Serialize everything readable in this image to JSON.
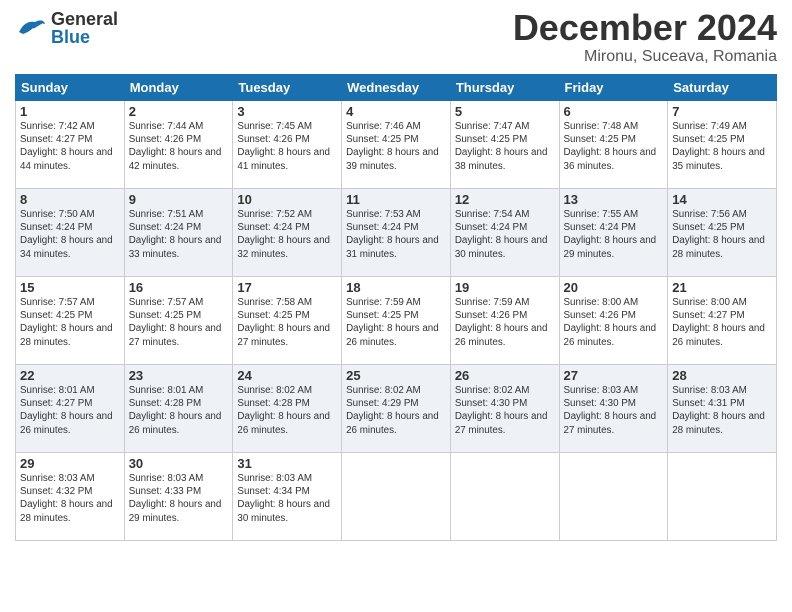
{
  "header": {
    "logo_general": "General",
    "logo_blue": "Blue",
    "month_title": "December 2024",
    "location": "Mironu, Suceava, Romania"
  },
  "days_of_week": [
    "Sunday",
    "Monday",
    "Tuesday",
    "Wednesday",
    "Thursday",
    "Friday",
    "Saturday"
  ],
  "weeks": [
    [
      {
        "day": "1",
        "sunrise": "Sunrise: 7:42 AM",
        "sunset": "Sunset: 4:27 PM",
        "daylight": "Daylight: 8 hours and 44 minutes."
      },
      {
        "day": "2",
        "sunrise": "Sunrise: 7:44 AM",
        "sunset": "Sunset: 4:26 PM",
        "daylight": "Daylight: 8 hours and 42 minutes."
      },
      {
        "day": "3",
        "sunrise": "Sunrise: 7:45 AM",
        "sunset": "Sunset: 4:26 PM",
        "daylight": "Daylight: 8 hours and 41 minutes."
      },
      {
        "day": "4",
        "sunrise": "Sunrise: 7:46 AM",
        "sunset": "Sunset: 4:25 PM",
        "daylight": "Daylight: 8 hours and 39 minutes."
      },
      {
        "day": "5",
        "sunrise": "Sunrise: 7:47 AM",
        "sunset": "Sunset: 4:25 PM",
        "daylight": "Daylight: 8 hours and 38 minutes."
      },
      {
        "day": "6",
        "sunrise": "Sunrise: 7:48 AM",
        "sunset": "Sunset: 4:25 PM",
        "daylight": "Daylight: 8 hours and 36 minutes."
      },
      {
        "day": "7",
        "sunrise": "Sunrise: 7:49 AM",
        "sunset": "Sunset: 4:25 PM",
        "daylight": "Daylight: 8 hours and 35 minutes."
      }
    ],
    [
      {
        "day": "8",
        "sunrise": "Sunrise: 7:50 AM",
        "sunset": "Sunset: 4:24 PM",
        "daylight": "Daylight: 8 hours and 34 minutes."
      },
      {
        "day": "9",
        "sunrise": "Sunrise: 7:51 AM",
        "sunset": "Sunset: 4:24 PM",
        "daylight": "Daylight: 8 hours and 33 minutes."
      },
      {
        "day": "10",
        "sunrise": "Sunrise: 7:52 AM",
        "sunset": "Sunset: 4:24 PM",
        "daylight": "Daylight: 8 hours and 32 minutes."
      },
      {
        "day": "11",
        "sunrise": "Sunrise: 7:53 AM",
        "sunset": "Sunset: 4:24 PM",
        "daylight": "Daylight: 8 hours and 31 minutes."
      },
      {
        "day": "12",
        "sunrise": "Sunrise: 7:54 AM",
        "sunset": "Sunset: 4:24 PM",
        "daylight": "Daylight: 8 hours and 30 minutes."
      },
      {
        "day": "13",
        "sunrise": "Sunrise: 7:55 AM",
        "sunset": "Sunset: 4:24 PM",
        "daylight": "Daylight: 8 hours and 29 minutes."
      },
      {
        "day": "14",
        "sunrise": "Sunrise: 7:56 AM",
        "sunset": "Sunset: 4:25 PM",
        "daylight": "Daylight: 8 hours and 28 minutes."
      }
    ],
    [
      {
        "day": "15",
        "sunrise": "Sunrise: 7:57 AM",
        "sunset": "Sunset: 4:25 PM",
        "daylight": "Daylight: 8 hours and 28 minutes."
      },
      {
        "day": "16",
        "sunrise": "Sunrise: 7:57 AM",
        "sunset": "Sunset: 4:25 PM",
        "daylight": "Daylight: 8 hours and 27 minutes."
      },
      {
        "day": "17",
        "sunrise": "Sunrise: 7:58 AM",
        "sunset": "Sunset: 4:25 PM",
        "daylight": "Daylight: 8 hours and 27 minutes."
      },
      {
        "day": "18",
        "sunrise": "Sunrise: 7:59 AM",
        "sunset": "Sunset: 4:25 PM",
        "daylight": "Daylight: 8 hours and 26 minutes."
      },
      {
        "day": "19",
        "sunrise": "Sunrise: 7:59 AM",
        "sunset": "Sunset: 4:26 PM",
        "daylight": "Daylight: 8 hours and 26 minutes."
      },
      {
        "day": "20",
        "sunrise": "Sunrise: 8:00 AM",
        "sunset": "Sunset: 4:26 PM",
        "daylight": "Daylight: 8 hours and 26 minutes."
      },
      {
        "day": "21",
        "sunrise": "Sunrise: 8:00 AM",
        "sunset": "Sunset: 4:27 PM",
        "daylight": "Daylight: 8 hours and 26 minutes."
      }
    ],
    [
      {
        "day": "22",
        "sunrise": "Sunrise: 8:01 AM",
        "sunset": "Sunset: 4:27 PM",
        "daylight": "Daylight: 8 hours and 26 minutes."
      },
      {
        "day": "23",
        "sunrise": "Sunrise: 8:01 AM",
        "sunset": "Sunset: 4:28 PM",
        "daylight": "Daylight: 8 hours and 26 minutes."
      },
      {
        "day": "24",
        "sunrise": "Sunrise: 8:02 AM",
        "sunset": "Sunset: 4:28 PM",
        "daylight": "Daylight: 8 hours and 26 minutes."
      },
      {
        "day": "25",
        "sunrise": "Sunrise: 8:02 AM",
        "sunset": "Sunset: 4:29 PM",
        "daylight": "Daylight: 8 hours and 26 minutes."
      },
      {
        "day": "26",
        "sunrise": "Sunrise: 8:02 AM",
        "sunset": "Sunset: 4:30 PM",
        "daylight": "Daylight: 8 hours and 27 minutes."
      },
      {
        "day": "27",
        "sunrise": "Sunrise: 8:03 AM",
        "sunset": "Sunset: 4:30 PM",
        "daylight": "Daylight: 8 hours and 27 minutes."
      },
      {
        "day": "28",
        "sunrise": "Sunrise: 8:03 AM",
        "sunset": "Sunset: 4:31 PM",
        "daylight": "Daylight: 8 hours and 28 minutes."
      }
    ],
    [
      {
        "day": "29",
        "sunrise": "Sunrise: 8:03 AM",
        "sunset": "Sunset: 4:32 PM",
        "daylight": "Daylight: 8 hours and 28 minutes."
      },
      {
        "day": "30",
        "sunrise": "Sunrise: 8:03 AM",
        "sunset": "Sunset: 4:33 PM",
        "daylight": "Daylight: 8 hours and 29 minutes."
      },
      {
        "day": "31",
        "sunrise": "Sunrise: 8:03 AM",
        "sunset": "Sunset: 4:34 PM",
        "daylight": "Daylight: 8 hours and 30 minutes."
      },
      null,
      null,
      null,
      null
    ]
  ]
}
